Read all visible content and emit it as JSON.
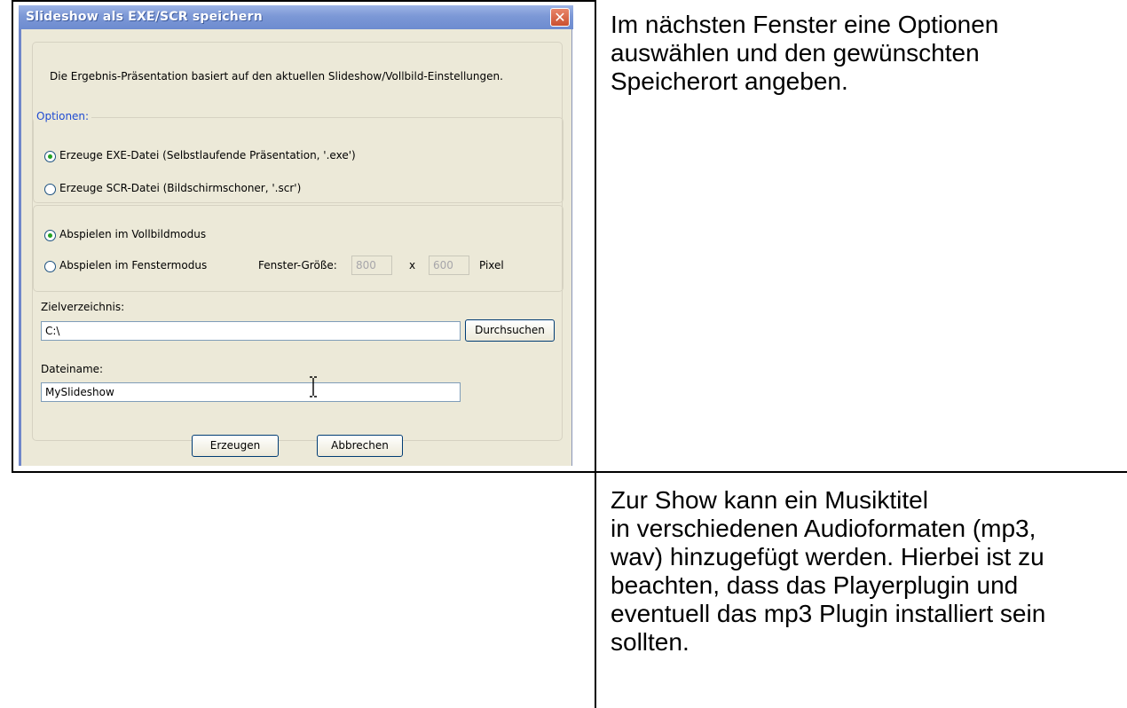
{
  "dialog": {
    "title": "Slideshow als EXE/SCR speichern",
    "close_glyph": "✕",
    "intro": "Die Ergebnis-Präsentation basiert auf den aktuellen Slideshow/Vollbild-Einstellungen.",
    "options_legend": "Optionen:",
    "radio_exe": "Erzeuge EXE-Datei (Selbstlaufende Präsentation, '.exe')",
    "radio_scr": "Erzeuge SCR-Datei (Bildschirmschoner, '.scr')",
    "radio_fullscreen": "Abspielen im Vollbildmodus",
    "radio_window": "Abspielen im Fenstermodus",
    "window_size_label": "Fenster-Größe:",
    "width_value": "800",
    "x_label": "x",
    "height_value": "600",
    "pixel_label": "Pixel",
    "target_dir_label": "Zielverzeichnis:",
    "target_dir_value": "C:\\",
    "browse_button": "Durchsuchen",
    "filename_label": "Dateiname:",
    "filename_value": "MySlideshow",
    "create_button": "Erzeugen",
    "cancel_button": "Abbrechen",
    "selected_output": "exe",
    "selected_mode": "fullscreen"
  },
  "document": {
    "cell_top_right": "Im nächsten Fenster eine Optionen\nauswählen und den gewünschten\nSpeicherort angeben.",
    "cell_bottom_right": "Zur Show kann ein Musiktitel\nin verschiedenen Audioformaten (mp3,\nwav) hinzugefügt werden. Hierbei ist zu\nbeachten, dass das Playerplugin und\neventuell das mp3 Plugin installiert sein\nsollten."
  }
}
